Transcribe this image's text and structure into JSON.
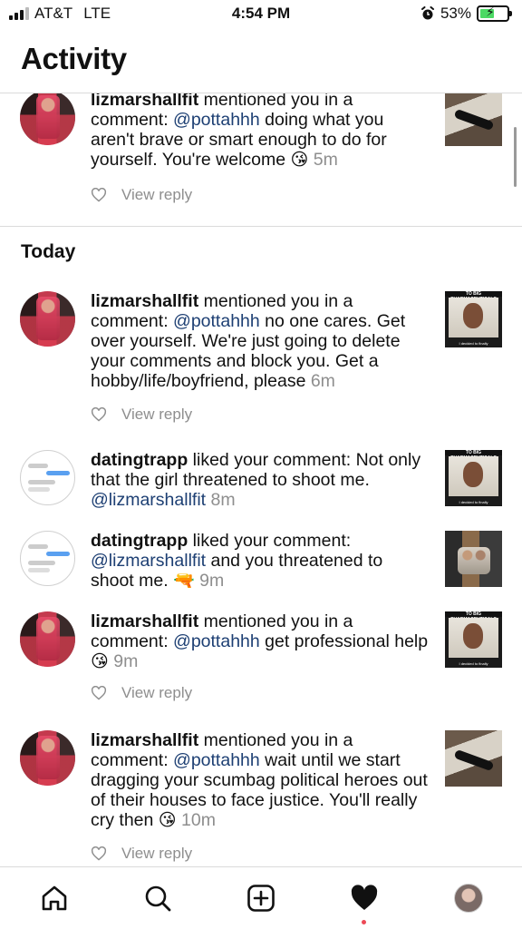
{
  "status_bar": {
    "carrier": "AT&T",
    "network": "LTE",
    "time": "4:54 PM",
    "battery_percent": "53%",
    "battery_level": 0.53,
    "alarm_icon": "alarm-clock-icon",
    "battery_color": "#4cd964"
  },
  "header": {
    "title": "Activity"
  },
  "top_item": {
    "username": "lizmarshallfit",
    "action": " mentioned you in a comment: ",
    "mention": "@pottahhh",
    "body": " doing what you aren't brave or smart enough to do for yourself. You're welcome ",
    "emoji": "😘",
    "time": "5m",
    "view_reply": "View reply"
  },
  "section_title": "Today",
  "items": [
    {
      "username": "lizmarshallfit",
      "action": " mentioned you in a comment: ",
      "mention": "@pottahhh",
      "body": " no one cares. Get over yourself. We're just going to delete your comments and block you. Get a hobby/life/boyfriend, please ",
      "emoji": "",
      "time": "6m",
      "view_reply": "View reply",
      "thumb_caption": "TO BIG PHARMACEUTICALS",
      "thumb_subcaption": "I decided to finally"
    },
    {
      "username": "datingtrapp",
      "action": " liked your comment: ",
      "mention": "",
      "body": "Not only that the girl threatened to shoot me. ",
      "mention2": "@lizmarshallfit",
      "emoji": "",
      "time": "8m",
      "thumb_caption": "TO BIG PHARMACEUTICALS",
      "thumb_subcaption": "I decided to finally"
    },
    {
      "username": "datingtrapp",
      "action": " liked your comment: ",
      "mention": "@lizmarshallfit",
      "body": " and you threatened to shoot me. ",
      "emoji": "🔫",
      "time": "9m"
    },
    {
      "username": "lizmarshallfit",
      "action": " mentioned you in a comment: ",
      "mention": "@pottahhh",
      "body": " get professional help ",
      "emoji": "😘",
      "time": "9m",
      "view_reply": "View reply",
      "thumb_caption": "TO BIG PHARMACEUTICALS",
      "thumb_subcaption": "I decided to finally"
    },
    {
      "username": "lizmarshallfit",
      "action": " mentioned you in a comment: ",
      "mention": "@pottahhh",
      "body": " wait until we start dragging your scumbag political heroes out of their houses to face justice. You'll really cry then ",
      "emoji": "😘",
      "time": "10m",
      "view_reply": "View reply"
    }
  ],
  "tab_bar": {
    "home_icon": "home-icon",
    "search_icon": "search-icon",
    "create_icon": "add-post-icon",
    "activity_icon": "heart-filled-icon",
    "profile_icon": "profile-avatar",
    "notification_dot_color": "#ed4956"
  }
}
